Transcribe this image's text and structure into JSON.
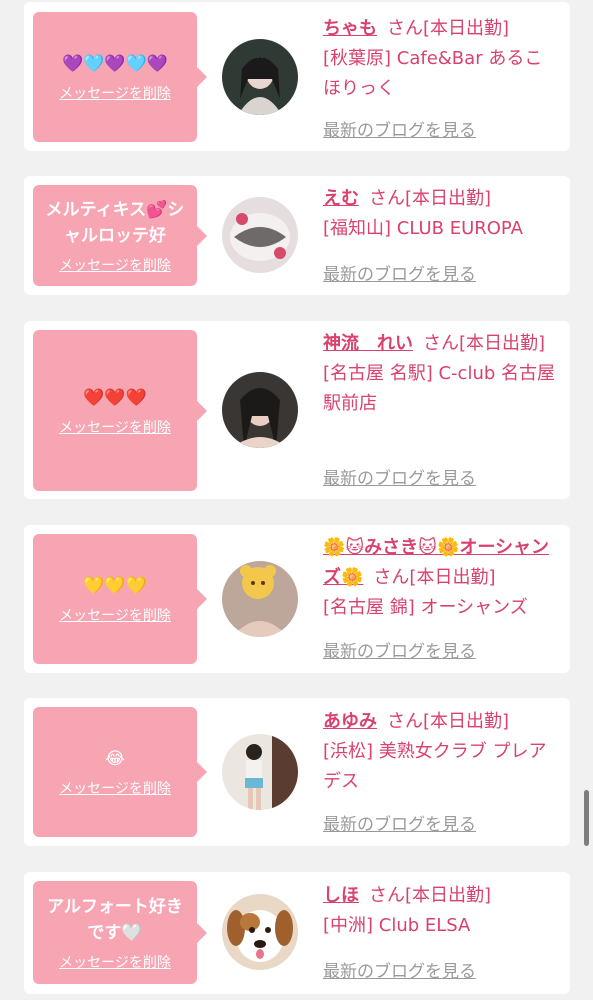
{
  "delete_label": "メッセージを削除",
  "blog_label": "最新のブログを見る",
  "san_label": "さん[本日出勤]",
  "cards": [
    {
      "message": "💜🩵💜🩵💜",
      "name": "ちゃも",
      "shop": "[秋葉原] Cafe&Bar あるこほりっく"
    },
    {
      "message": "メルティキス💕シャルロッテ好",
      "name": "えむ",
      "shop": "[福知山] CLUB EUROPA"
    },
    {
      "message": "❤️❤️❤️",
      "name": "神流　れい",
      "shop": "[名古屋 名駅] C-club 名古屋駅前店"
    },
    {
      "message": "💛💛💛",
      "name": "🌼🐱みさき🐱🌼オーシャンズ🌼",
      "shop": "[名古屋 錦] オーシャンズ"
    },
    {
      "message": "😂",
      "name": "あゆみ",
      "shop": "[浜松] 美熟女クラブ プレアデス"
    },
    {
      "message": "アルフォート好きです🤍",
      "name": "しほ",
      "shop": "[中洲] Club ELSA"
    }
  ]
}
